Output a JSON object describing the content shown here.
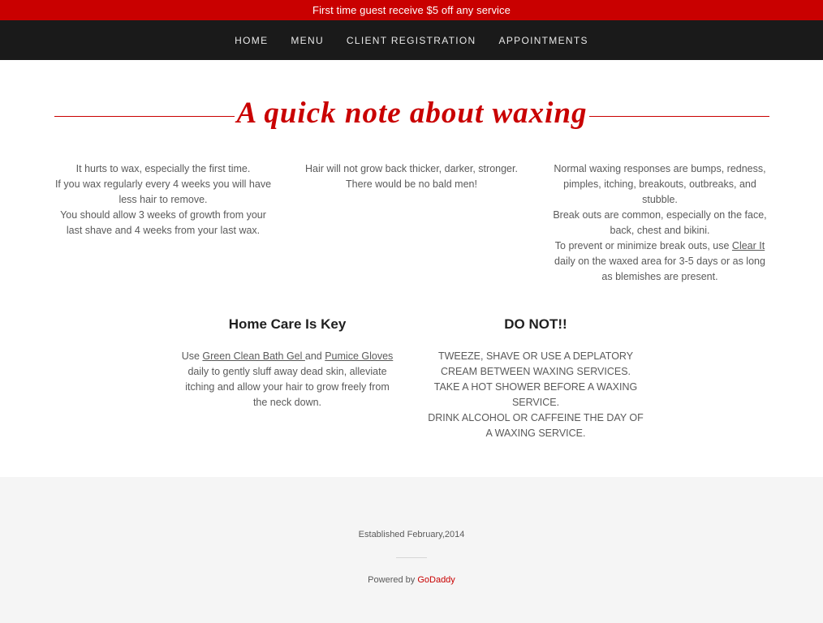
{
  "promo": {
    "text": "First time guest receive $5 off any service"
  },
  "nav": {
    "items": [
      {
        "label": "HOME"
      },
      {
        "label": "MENU"
      },
      {
        "label": "CLIENT REGISTRATION"
      },
      {
        "label": "APPOINTMENTS"
      }
    ]
  },
  "main": {
    "title": "A quick note about waxing",
    "col1": {
      "lines": [
        "It hurts to wax, especially the first time.",
        "If you wax regularly every 4 weeks you will have less hair to remove.",
        "You should allow 3 weeks of growth from your last shave and 4 weeks from your last wax."
      ]
    },
    "col2": {
      "lines": [
        "Hair will not grow back thicker, darker, stronger.",
        "There would be no bald men!"
      ]
    },
    "col3": {
      "line1": "Normal waxing responses are bumps, redness, pimples, itching, breakouts, outbreaks, and stubble.",
      "line2": "Break outs are common, especially on the face, back, chest and bikini.",
      "line3_prefix": "To prevent or minimize break outs, use ",
      "line3_link": "Clear It",
      "line3_suffix": " daily on the waxed area for 3-5 days or as long as blemishes are present."
    },
    "home_care": {
      "heading": "Home Care Is Key",
      "prefix": "Use ",
      "link1": "Green Clean Bath Gel ",
      "middle": "and ",
      "link2": "Pumice Gloves",
      "suffix": " daily to gently sluff away dead skin, alleviate itching and allow your hair to grow freely from the neck down."
    },
    "do_not": {
      "heading": "DO NOT!!",
      "lines": [
        "TWEEZE, SHAVE OR USE A DEPLATORY CREAM BETWEEN WAXING SERVICES.",
        "TAKE A HOT SHOWER BEFORE A WAXING SERVICE.",
        "DRINK ALCOHOL OR CAFFEINE THE DAY OF A WAXING SERVICE."
      ]
    }
  },
  "footer": {
    "established": "Established February,2014",
    "powered_prefix": "Powered by ",
    "powered_link": "GoDaddy"
  },
  "colors": {
    "accent": "#c90000",
    "nav_bg": "#1a1a1a",
    "footer_bg": "#f5f5f5"
  }
}
